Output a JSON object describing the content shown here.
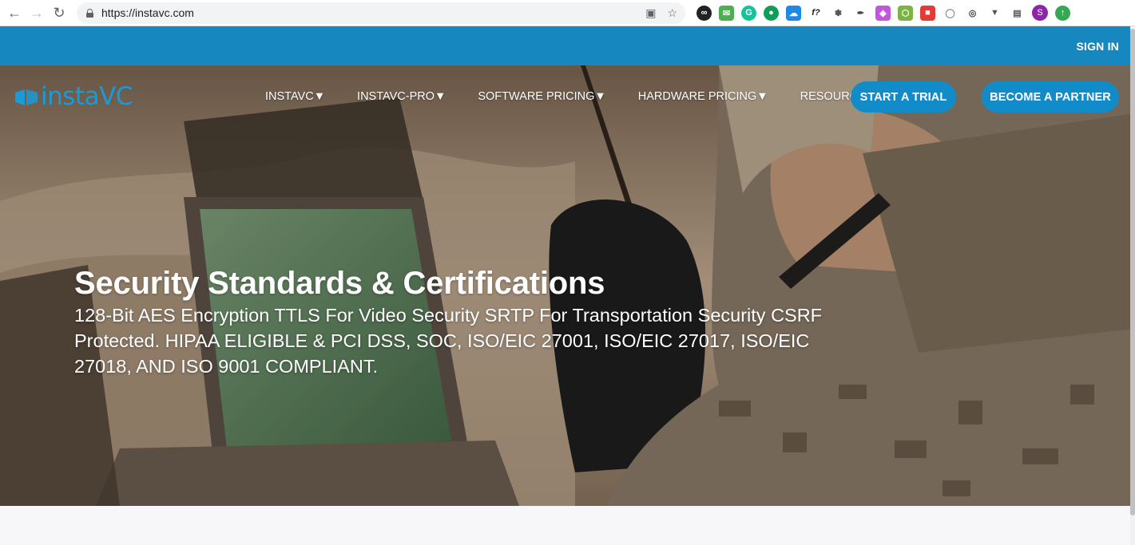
{
  "browser": {
    "url": "https://instavc.com",
    "profile_initial": "S"
  },
  "topbar": {
    "signin_label": "SIGN IN"
  },
  "header": {
    "logo_text": "instaVC",
    "nav": [
      {
        "label": "INSTAVC▼"
      },
      {
        "label": "INSTAVC-PRO▼"
      },
      {
        "label": "SOFTWARE PRICING▼"
      },
      {
        "label": "HARDWARE PRICING▼"
      },
      {
        "label": "RESOURCES▼"
      }
    ],
    "trial_button": "START A TRIAL",
    "partner_button": "BECOME A PARTNER"
  },
  "hero": {
    "title": "Security Standards & Certifications",
    "subtitle": "128-Bit AES Encryption TTLS For Video Security SRTP For Transportation Security CSRF Protected. HIPAA ELIGIBLE & PCI DSS, SOC, ISO/EIC 27001, ISO/EIC 27017, ISO/EIC 27018, AND ISO 9001 COMPLIANT."
  },
  "colors": {
    "brand_blue": "#1787bf",
    "button_blue": "#128bc9",
    "logo_blue": "#1a9ad6"
  }
}
